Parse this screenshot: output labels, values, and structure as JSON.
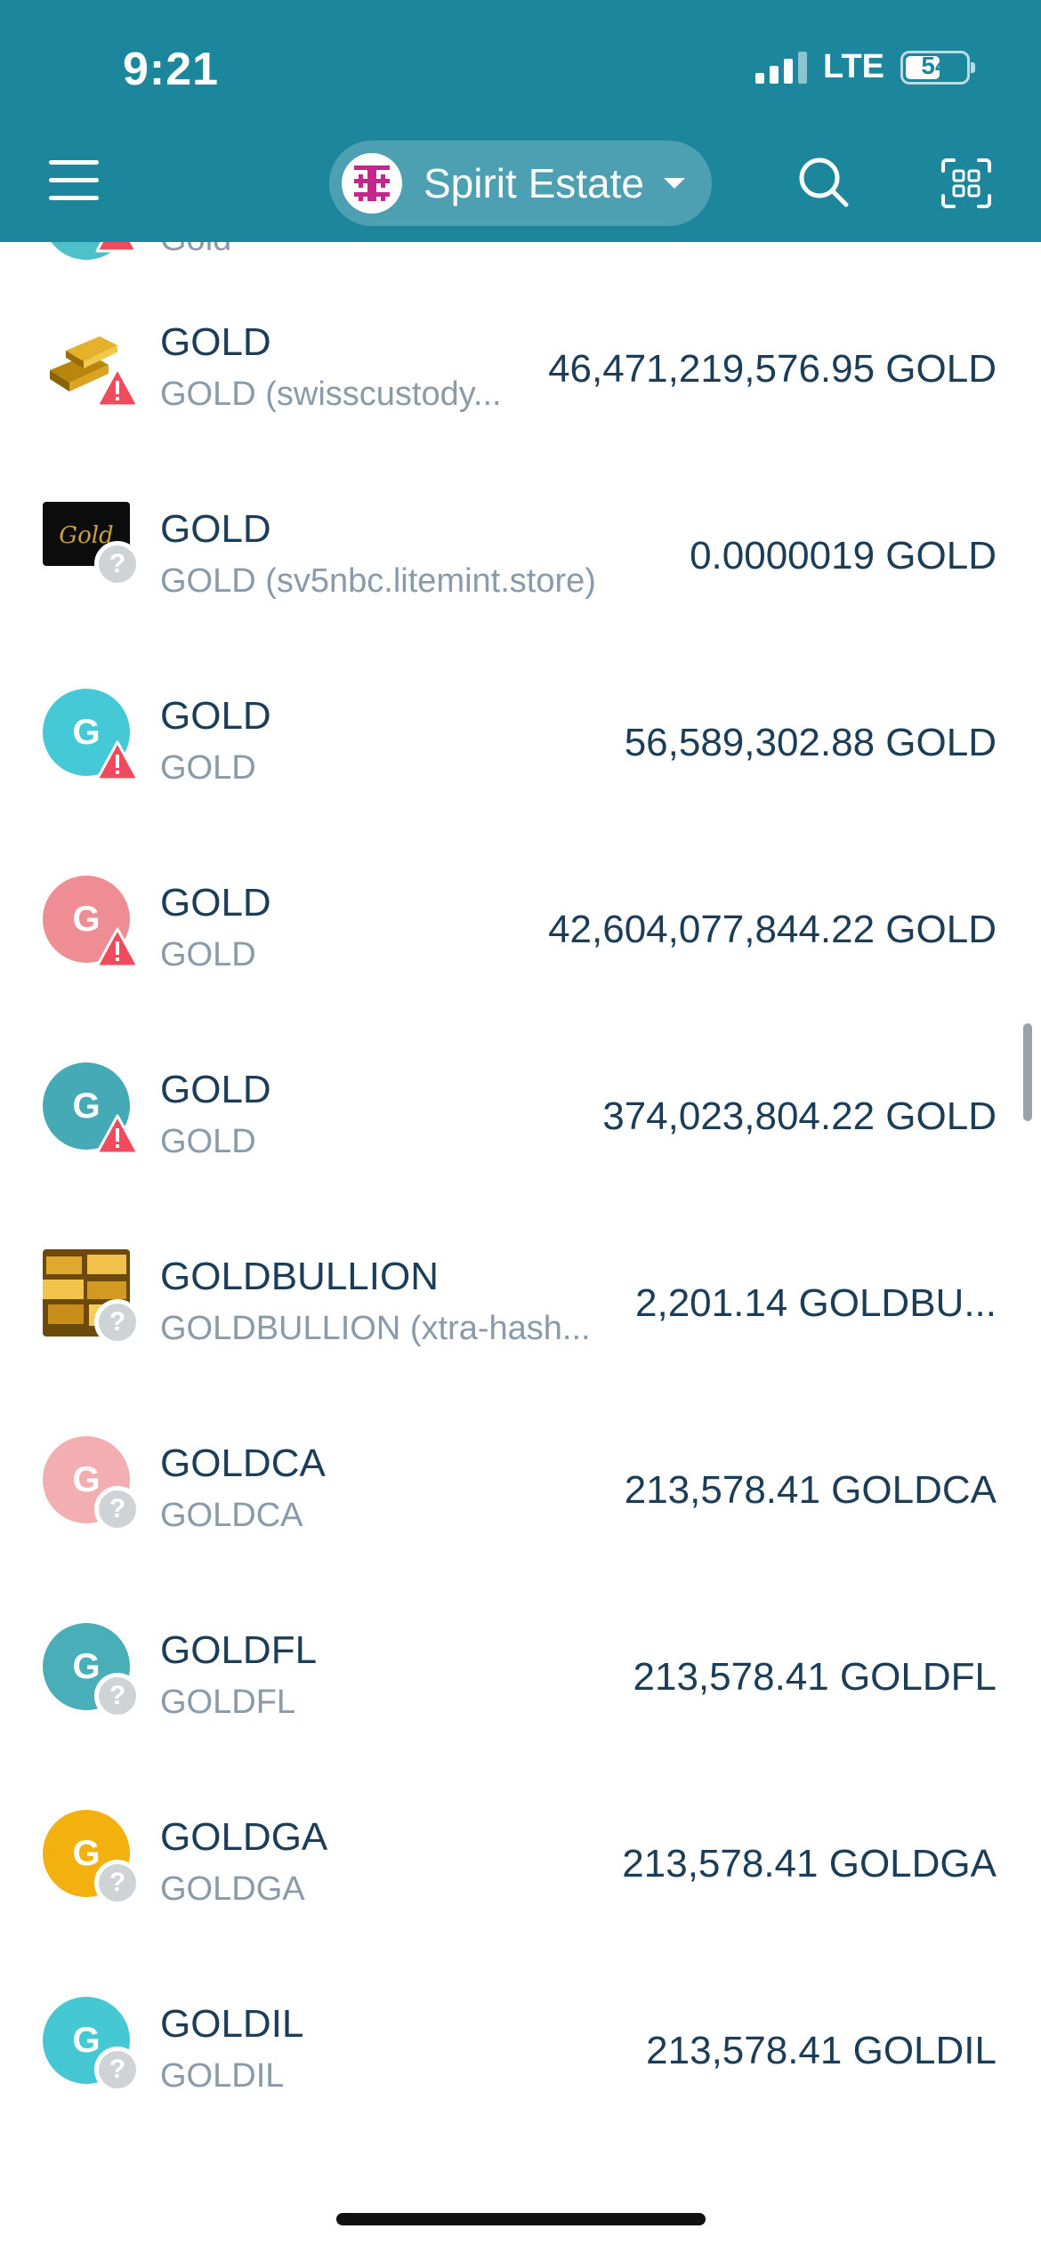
{
  "status_bar": {
    "time": "9:21",
    "network": "LTE",
    "battery": "54"
  },
  "header": {
    "account_name": "Spirit Estate"
  },
  "colors": {
    "header_bg": "#1b869c",
    "warning": "#ef4b5c"
  },
  "partial_row": {
    "subtitle": "Gold",
    "icon_color": "#4dc0c9",
    "badge": "warning"
  },
  "tokens": [
    {
      "title": "GOLD",
      "subtitle": "GOLD (swisscustody...",
      "amount": "46,471,219,576.95 GOLD",
      "icon": "gold-bars-image",
      "badge": "warning"
    },
    {
      "title": "GOLD",
      "subtitle": "GOLD (sv5nbc.litemint.store)",
      "amount": "0.0000019 GOLD",
      "icon": "gold-logo-image",
      "badge": "unknown"
    },
    {
      "title": "GOLD",
      "subtitle": "GOLD",
      "amount": "56,589,302.88 GOLD",
      "icon_letter": "G",
      "icon_color": "#45c9d6",
      "badge": "warning"
    },
    {
      "title": "GOLD",
      "subtitle": "GOLD",
      "amount": "42,604,077,844.22 GOLD",
      "icon_letter": "G",
      "icon_color": "#ee8d93",
      "badge": "warning"
    },
    {
      "title": "GOLD",
      "subtitle": "GOLD",
      "amount": "374,023,804.22 GOLD",
      "icon_letter": "G",
      "icon_color": "#45a9b6",
      "badge": "warning"
    },
    {
      "title": "GOLDBULLION",
      "subtitle": "GOLDBULLION (xtra-hash...",
      "amount": "2,201.14 GOLDBU...",
      "icon": "gold-bullion-image",
      "badge": "unknown"
    },
    {
      "title": "GOLDCA",
      "subtitle": "GOLDCA",
      "amount": "213,578.41 GOLDCA",
      "icon_letter": "G",
      "icon_color": "#f3aeb2",
      "badge": "unknown"
    },
    {
      "title": "GOLDFL",
      "subtitle": "GOLDFL",
      "amount": "213,578.41 GOLDFL",
      "icon_letter": "G",
      "icon_color": "#4aaeb8",
      "badge": "unknown"
    },
    {
      "title": "GOLDGA",
      "subtitle": "GOLDGA",
      "amount": "213,578.41 GOLDGA",
      "icon_letter": "G",
      "icon_color": "#f3b10f",
      "badge": "unknown"
    },
    {
      "title": "GOLDIL",
      "subtitle": "GOLDIL",
      "amount": "213,578.41 GOLDIL",
      "icon_letter": "G",
      "icon_color": "#46c8d4",
      "badge": "unknown"
    }
  ]
}
